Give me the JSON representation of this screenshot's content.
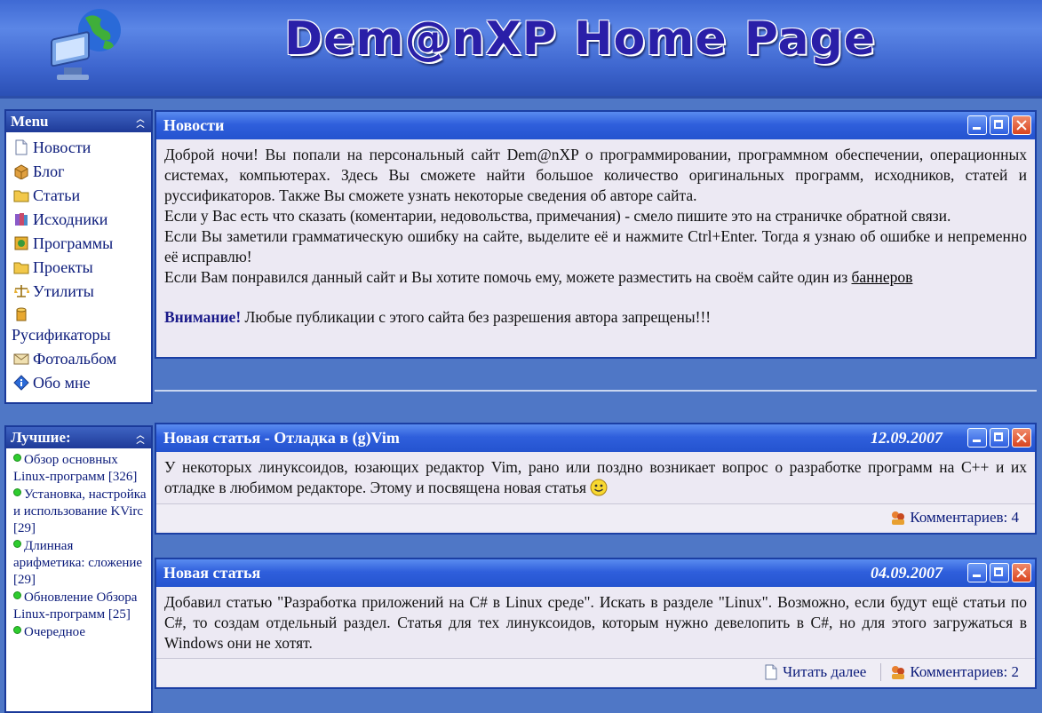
{
  "header": {
    "title": "Dem@nXP Home Page"
  },
  "menu": {
    "title": "Menu",
    "items": [
      {
        "label": "Новости",
        "icon": "page-icon"
      },
      {
        "label": "Блог",
        "icon": "box-icon"
      },
      {
        "label": "Статьи",
        "icon": "folder-icon"
      },
      {
        "label": "Исходники",
        "icon": "books-icon"
      },
      {
        "label": "Программы",
        "icon": "programs-icon"
      },
      {
        "label": "Проекты",
        "icon": "folder-icon"
      },
      {
        "label": "Утилиты",
        "icon": "scales-icon"
      },
      {
        "label": "Русификаторы",
        "icon": "cylinder-icon"
      },
      {
        "label": "Фотоальбом",
        "icon": "envelope-icon"
      },
      {
        "label": "Обо мне",
        "icon": "info-icon"
      }
    ]
  },
  "best": {
    "title": "Лучшие:",
    "items": [
      {
        "label": "Обзор основных Linux-программ [326]"
      },
      {
        "label": "Установка, настройка и использование KVirc [29]"
      },
      {
        "label": "Длинная арифметика: сложение [29]"
      },
      {
        "label": "Обновление Обзора Linux-программ [25]"
      },
      {
        "label": "Очередное"
      }
    ]
  },
  "news": {
    "title": "Новости",
    "p1": "Доброй ночи! Вы попали на персональный сайт Dem@nXP о программировании, программном обеспечении, операционных системах, компьютерах. Здесь Вы сможете найти большое количество оригинальных программ, исходников, статей и руссификаторов. Также Вы сможете узнать некоторые сведения об авторе сайта.",
    "p2": "Если у Вас есть что сказать (коментарии, недовольства, примечания) - смело пишите это на страничке обратной связи.",
    "p3": "Если Вы заметили грамматическую ошибку на сайте, выделите её и нажмите Ctrl+Enter. Тогда я узнаю об ошибке и непременно её исправлю!",
    "p4": "Если Вам понравился данный сайт и Вы хотите помочь ему, можете разместить на своём сайте один из",
    "banner_link": "баннеров",
    "warn_label": "Внимание!",
    "warn_text": " Любые публикации с этого сайта без разрешения автора запрещены!!!"
  },
  "post1": {
    "title": "Новая статья - Отладка в (g)Vim",
    "date": "12.09.2007",
    "body": "У некоторых линуксоидов, юзающих редактор Vim, рано или поздно возникает вопрос о разработке программ на C++ и их отладке в любимом редакторе. Этому и посвящена новая статья",
    "comments": "Комментариев: 4"
  },
  "post2": {
    "title": "Новая статья",
    "date": "04.09.2007",
    "body": "Добавил статью \"Разработка приложений на C# в Linux среде\". Искать в разделе \"Linux\". Возможно, если будут ещё статьи по C#, то создам отдельный раздел. Статья для тех линуксоидов, которым нужно девелопить в C#, но для этого загружаться в Windows они не хотят.",
    "read_more": "Читать далее",
    "comments": "Комментариев: 2"
  },
  "colors": {
    "background": "#4f77c6",
    "title_bar": "#2f5fdc",
    "panel_border": "#1b3a9a",
    "close": "#d9441e"
  }
}
